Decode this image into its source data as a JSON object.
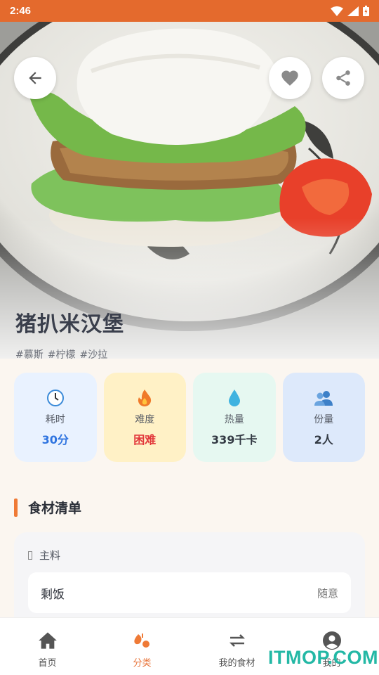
{
  "status_bar": {
    "time": "2:46"
  },
  "recipe": {
    "title": "猪扒米汉堡",
    "tags": [
      "#慕斯",
      "#柠檬",
      "#沙拉"
    ]
  },
  "stats": [
    {
      "label": "耗时",
      "value": "30分",
      "icon": "clock-icon",
      "bg": "#e9f2ff",
      "value_color": "#2f74e0"
    },
    {
      "label": "难度",
      "value": "困难",
      "icon": "fire-icon",
      "bg": "#fff1c6",
      "value_color": "#e2383b"
    },
    {
      "label": "热量",
      "value": "339千卡",
      "icon": "droplet-icon",
      "bg": "#e6f8f1",
      "value_color": "#333a44"
    },
    {
      "label": "份量",
      "value": "2人",
      "icon": "people-icon",
      "bg": "#dde9fb",
      "value_color": "#333a44"
    }
  ],
  "ingredients": {
    "section_title": "食材清单",
    "group_title": "主料",
    "items": [
      {
        "name": "剩饭",
        "amount": "随意"
      }
    ]
  },
  "tab_bar": {
    "tabs": [
      {
        "label": "首页",
        "icon": "home-icon"
      },
      {
        "label": "分类",
        "icon": "category-icon",
        "active": true
      },
      {
        "label": "我的食材",
        "icon": "swap-icon"
      },
      {
        "label": "我的",
        "icon": "account-icon"
      }
    ]
  },
  "watermark": "ITMOP.COM",
  "colors": {
    "accent": "#e46a2d",
    "active_tab": "#e8743a"
  }
}
